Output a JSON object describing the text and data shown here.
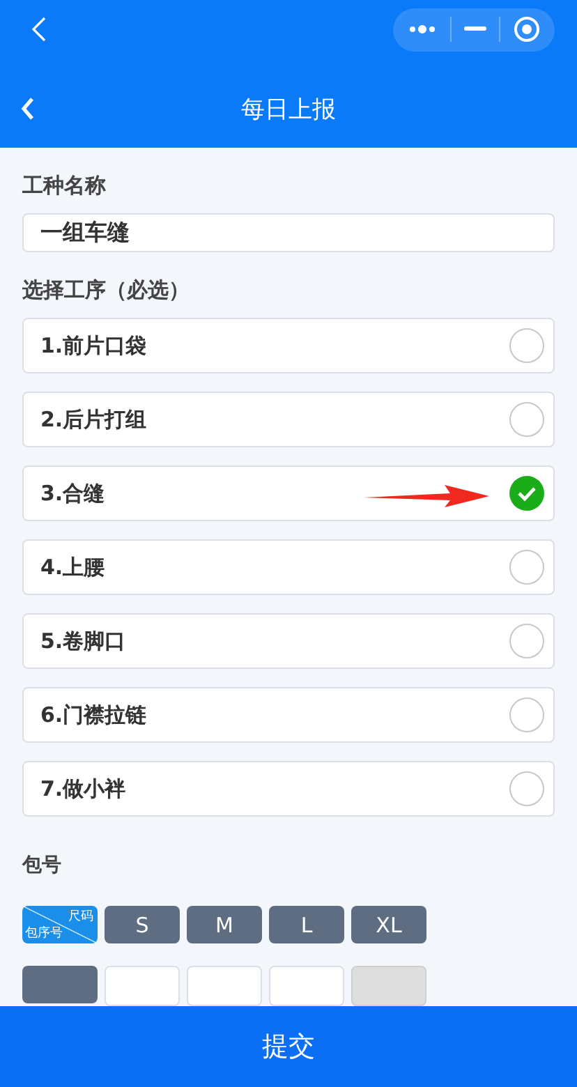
{
  "nav_bar": {
    "title": "每日上报"
  },
  "job_field": {
    "label": "工种名称",
    "value": "一组车缝"
  },
  "process_section": {
    "label": "选择工序（必选）"
  },
  "processes": [
    {
      "label": "1.前片口袋",
      "selected": false
    },
    {
      "label": "2.后片打组",
      "selected": false
    },
    {
      "label": "3.合缝",
      "selected": true
    },
    {
      "label": "4.上腰",
      "selected": false
    },
    {
      "label": "5.卷脚口",
      "selected": false
    },
    {
      "label": "6.门襟拉链",
      "selected": false
    },
    {
      "label": "7.做小袢",
      "selected": false
    }
  ],
  "bundle_section": {
    "label": "包号",
    "corner_top": "尺码",
    "corner_bottom": "包序号",
    "sizes": [
      "S",
      "M",
      "L",
      "XL"
    ],
    "partial_row": [
      {
        "disabled": false
      },
      {
        "disabled": false
      },
      {
        "disabled": false
      },
      {
        "disabled": true
      }
    ]
  },
  "submit_button": "提交"
}
